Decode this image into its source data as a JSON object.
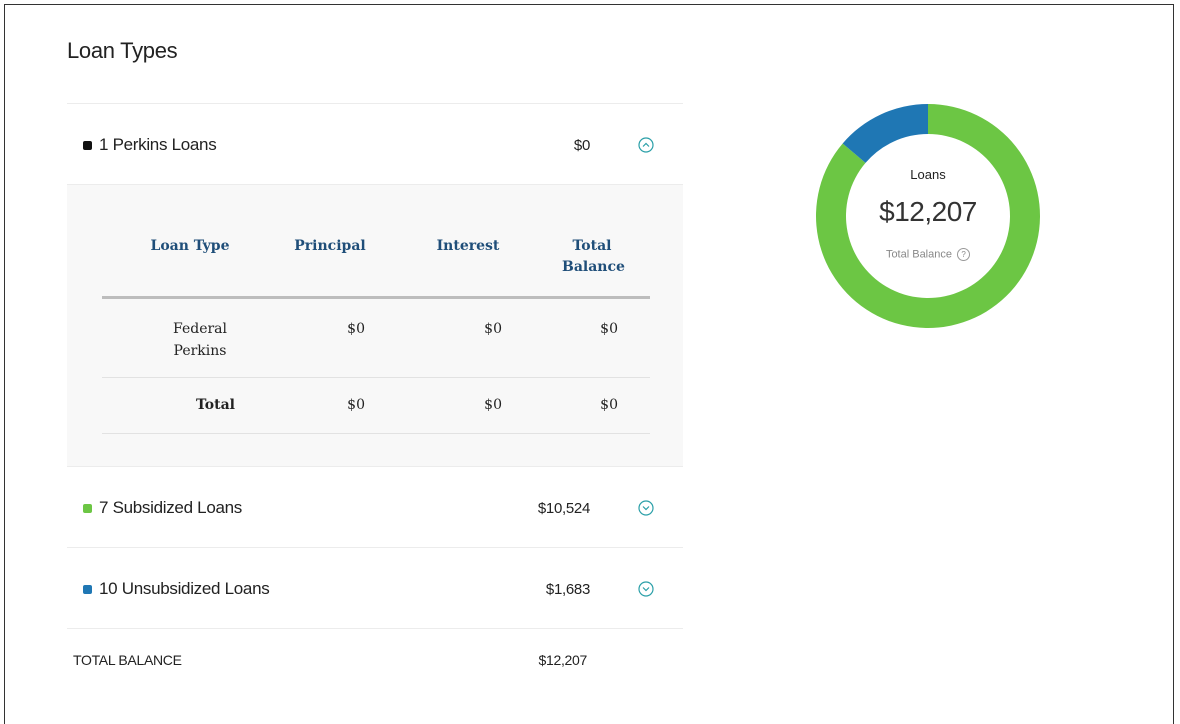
{
  "page": {
    "title": "Loan Types"
  },
  "loans": [
    {
      "label": "1 Perkins Loans",
      "amount": "$0",
      "color": "#111111",
      "expanded": true
    },
    {
      "label": "7 Subsidized Loans",
      "amount": "$10,524",
      "color": "#6cc644",
      "expanded": false
    },
    {
      "label": "10 Unsubsidized Loans",
      "amount": "$1,683",
      "color": "#1f77b4",
      "expanded": false
    }
  ],
  "detail_table": {
    "headers": [
      "Loan Type",
      "Principal",
      "Interest",
      "Total Balance"
    ],
    "rows": [
      {
        "type": "Federal Perkins",
        "principal": "$0",
        "interest": "$0",
        "total": "$0"
      }
    ],
    "total": {
      "type": "Total",
      "principal": "$0",
      "interest": "$0",
      "total": "$0"
    }
  },
  "summary": {
    "total_label": "TOTAL BALANCE",
    "total_value": "$12,207"
  },
  "donut": {
    "label": "Loans",
    "value": "$12,207",
    "sublabel": "Total Balance",
    "help_icon": "question-circle-icon"
  },
  "chart_data": {
    "type": "pie",
    "donut": true,
    "slices": [
      {
        "name": "Perkins",
        "value": 0,
        "color": "#111111"
      },
      {
        "name": "Subsidized",
        "value": 10524,
        "color": "#6cc644"
      },
      {
        "name": "Unsubsidized",
        "value": 1683,
        "color": "#1f77b4"
      }
    ]
  },
  "colors": {
    "accent_header": "#1f4e79",
    "chevron": "#2a9fa8"
  }
}
